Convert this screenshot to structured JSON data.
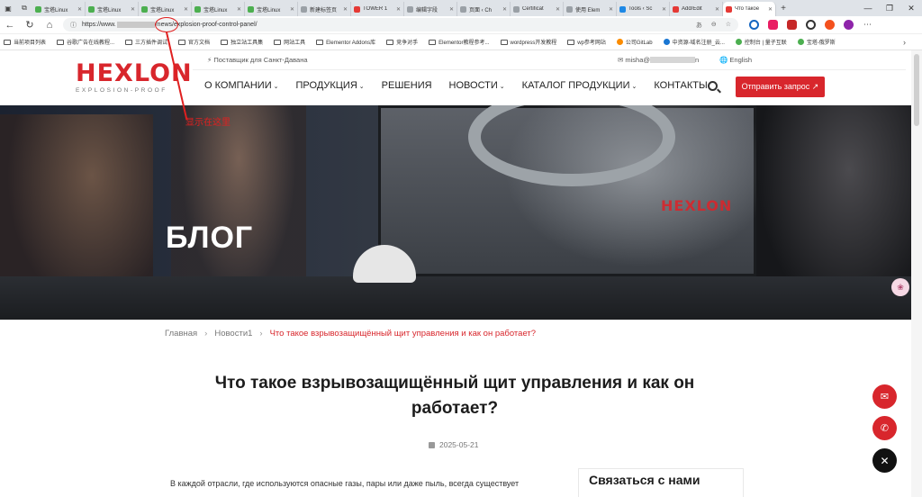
{
  "browser": {
    "tabs": [
      {
        "label": "宝塔Linux",
        "fav": "green"
      },
      {
        "label": "宝塔Linux",
        "fav": "green"
      },
      {
        "label": "宝塔Linux",
        "fav": "green"
      },
      {
        "label": "宝塔Linux",
        "fav": "green"
      },
      {
        "label": "宝塔Linux",
        "fav": "green"
      },
      {
        "label": "新建标签页",
        "fav": "gray"
      },
      {
        "label": "TOWER 1",
        "fav": "red"
      },
      {
        "label": "编辑字段",
        "fav": "gray"
      },
      {
        "label": "页面 ‹ Ch",
        "fav": "gray"
      },
      {
        "label": "Certificat",
        "fav": "gray"
      },
      {
        "label": "使用 Elem",
        "fav": "gray"
      },
      {
        "label": "Tools ‹ Sc",
        "fav": "blue"
      },
      {
        "label": "Add/Edit",
        "fav": "red"
      },
      {
        "label": "Что такое",
        "fav": "red"
      }
    ],
    "url_prefix": "https://www.",
    "url_suffix": "/news/explosion-proof-control-panel/",
    "bookmarks": [
      {
        "label": "当前项目列表",
        "icon": "folder"
      },
      {
        "label": "谷歌广告在线教程...",
        "icon": "folder"
      },
      {
        "label": "三方插件调试",
        "icon": "folder"
      },
      {
        "label": "官方文档",
        "icon": "folder"
      },
      {
        "label": "独立站工具集",
        "icon": "folder"
      },
      {
        "label": "网站工具",
        "icon": "folder"
      },
      {
        "label": "Elementor Addons库",
        "icon": "folder"
      },
      {
        "label": "竞争对手",
        "icon": "folder"
      },
      {
        "label": "Elementor教程参考...",
        "icon": "folder"
      },
      {
        "label": "wordpress开发教程",
        "icon": "folder"
      },
      {
        "label": "wp参考网站",
        "icon": "folder"
      },
      {
        "label": "公司GitLab",
        "icon": "dot-orange"
      },
      {
        "label": "中资源-域名注册_云...",
        "icon": "dot-blue"
      },
      {
        "label": "控制台 | 量子互联",
        "icon": "dot"
      },
      {
        "label": "宝塔-俄罗斯",
        "icon": "dot"
      }
    ]
  },
  "header": {
    "logo_word": "HEXLON",
    "logo_sub": "EXPLOSION-PROOF",
    "top_info": "⚡ Поставщик для Санкт-Давана",
    "email": "✉ misha@",
    "language": "🌐 English",
    "nav": [
      {
        "label": "О КОМПАНИИ",
        "caret": true
      },
      {
        "label": "ПРОДУКЦИЯ",
        "caret": true
      },
      {
        "label": "РЕШЕНИЯ",
        "caret": false
      },
      {
        "label": "НОВОСТИ",
        "caret": true
      },
      {
        "label": "КАТАЛОГ ПРОДУКЦИИ",
        "caret": true
      },
      {
        "label": "КОНТАКТЫ",
        "caret": false
      }
    ],
    "cta_label": "Отправить запрос ↗"
  },
  "hero": {
    "title": "БЛОГ",
    "screen_logo": "HEXLON"
  },
  "breadcrumb": {
    "home": "Главная",
    "section": "Новости1",
    "current": "Что такое взрывозащищённый щит управления и как он работает?"
  },
  "article": {
    "title": "Что такое взрывозащищённый щит управления и как он работает?",
    "date": "2025-05-21",
    "intro": "В каждой отрасли, где используются опасные газы, пары или даже пыль, всегда существует"
  },
  "sidebar": {
    "contact_heading": "Связаться с нами"
  },
  "annotation": {
    "text": "显示在这里",
    "color": "#e02020"
  },
  "colors": {
    "brand_red": "#d8262c"
  }
}
